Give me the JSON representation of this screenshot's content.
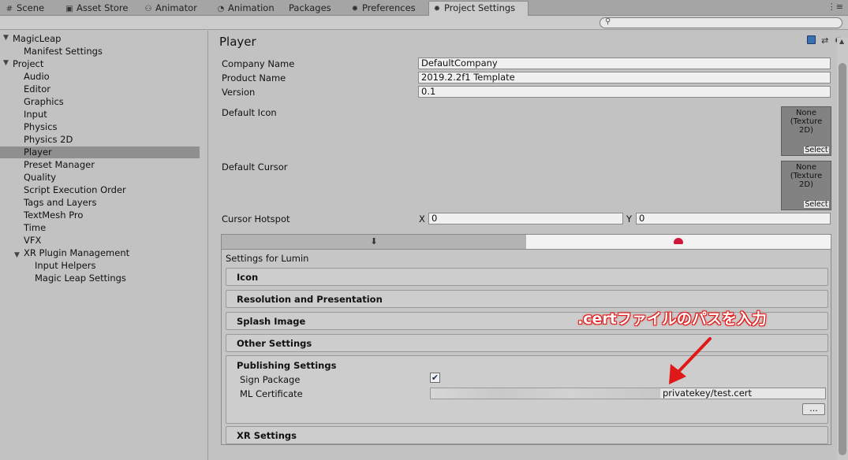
{
  "tabs": [
    {
      "label": "Scene",
      "icon": "grid-icon"
    },
    {
      "label": "Asset Store",
      "icon": "store-icon"
    },
    {
      "label": "Animator",
      "icon": "animator-icon"
    },
    {
      "label": "Animation",
      "icon": "clock-icon"
    },
    {
      "label": "Packages",
      "icon": ""
    },
    {
      "label": "Preferences",
      "icon": "gear-icon"
    },
    {
      "label": "Project Settings",
      "icon": "gear-icon",
      "active": true
    }
  ],
  "search": {
    "placeholder": ""
  },
  "sidebar": {
    "items": [
      {
        "label": "MagicLeap",
        "level": 0,
        "expanded": true
      },
      {
        "label": "Manifest Settings",
        "level": 1
      },
      {
        "label": "Project",
        "level": 0,
        "expanded": true
      },
      {
        "label": "Audio",
        "level": 1
      },
      {
        "label": "Editor",
        "level": 1
      },
      {
        "label": "Graphics",
        "level": 1
      },
      {
        "label": "Input",
        "level": 1
      },
      {
        "label": "Physics",
        "level": 1
      },
      {
        "label": "Physics 2D",
        "level": 1
      },
      {
        "label": "Player",
        "level": 1,
        "selected": true
      },
      {
        "label": "Preset Manager",
        "level": 1
      },
      {
        "label": "Quality",
        "level": 1
      },
      {
        "label": "Script Execution Order",
        "level": 1
      },
      {
        "label": "Tags and Layers",
        "level": 1
      },
      {
        "label": "TextMesh Pro",
        "level": 1
      },
      {
        "label": "Time",
        "level": 1
      },
      {
        "label": "VFX",
        "level": 1
      },
      {
        "label": "XR Plugin Management",
        "level": 1,
        "expanded": true
      },
      {
        "label": "Input Helpers",
        "level": 2
      },
      {
        "label": "Magic Leap Settings",
        "level": 2
      }
    ]
  },
  "player": {
    "title": "Player",
    "company_label": "Company Name",
    "company_value": "DefaultCompany",
    "product_label": "Product Name",
    "product_value": "2019.2.2f1 Template",
    "version_label": "Version",
    "version_value": "0.1",
    "default_icon_label": "Default Icon",
    "default_cursor_label": "Default Cursor",
    "texture_none": "None\n(Texture\n2D)",
    "select_label": "Select",
    "hotspot_label": "Cursor Hotspot",
    "hotspot_x_label": "X",
    "hotspot_x_value": "0",
    "hotspot_y_label": "Y",
    "hotspot_y_value": "0"
  },
  "platform": {
    "settings_for": "Settings for Lumin",
    "sections": [
      "Icon",
      "Resolution and Presentation",
      "Splash Image",
      "Other Settings"
    ],
    "publishing": {
      "title": "Publishing Settings",
      "sign_package_label": "Sign Package",
      "sign_package_checked": true,
      "ml_cert_label": "ML Certificate",
      "ml_cert_value": "privatekey/test.cert",
      "browse_label": "..."
    },
    "xr_settings": "XR Settings"
  },
  "annotation": {
    "text": ".certファイルのパスを入力",
    "color": "#e01818"
  }
}
